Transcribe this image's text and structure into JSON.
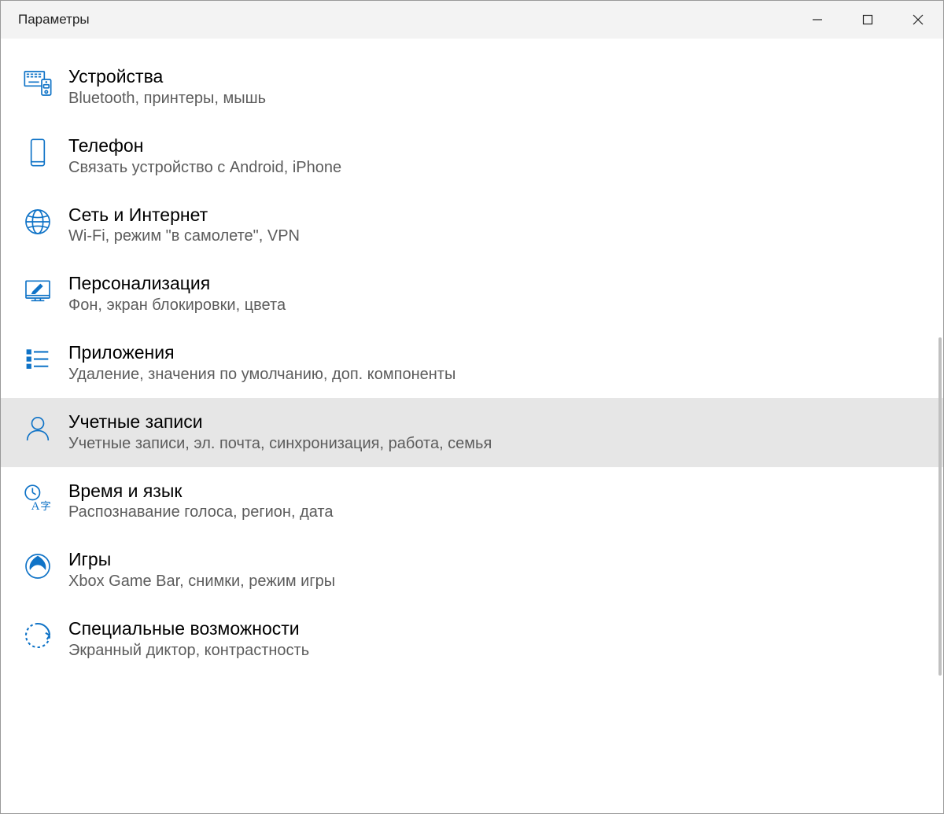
{
  "window": {
    "title": "Параметры"
  },
  "colors": {
    "accent": "#0f73c7",
    "muted": "#5c5c5c"
  },
  "categories": [
    {
      "id": "devices",
      "title": "Устройства",
      "desc": "Bluetooth, принтеры, мышь",
      "icon": "devices-icon",
      "selected": false
    },
    {
      "id": "phone",
      "title": "Телефон",
      "desc": "Связать устройство с Android, iPhone",
      "icon": "phone-icon",
      "selected": false
    },
    {
      "id": "network",
      "title": "Сеть и Интернет",
      "desc": "Wi-Fi, режим \"в самолете\", VPN",
      "icon": "globe-icon",
      "selected": false
    },
    {
      "id": "personalization",
      "title": "Персонализация",
      "desc": "Фон, экран блокировки, цвета",
      "icon": "personalization-icon",
      "selected": false
    },
    {
      "id": "apps",
      "title": "Приложения",
      "desc": "Удаление, значения по умолчанию, доп. компоненты",
      "icon": "apps-icon",
      "selected": false
    },
    {
      "id": "accounts",
      "title": "Учетные записи",
      "desc": "Учетные записи, эл. почта, синхронизация, работа, семья",
      "icon": "accounts-icon",
      "selected": true
    },
    {
      "id": "time-language",
      "title": "Время и язык",
      "desc": "Распознавание голоса, регион, дата",
      "icon": "time-language-icon",
      "selected": false
    },
    {
      "id": "gaming",
      "title": "Игры",
      "desc": "Xbox Game Bar, снимки, режим игры",
      "icon": "gaming-icon",
      "selected": false
    },
    {
      "id": "accessibility",
      "title": "Специальные возможности",
      "desc": "Экранный диктор, контрастность",
      "icon": "accessibility-icon",
      "selected": false
    }
  ]
}
